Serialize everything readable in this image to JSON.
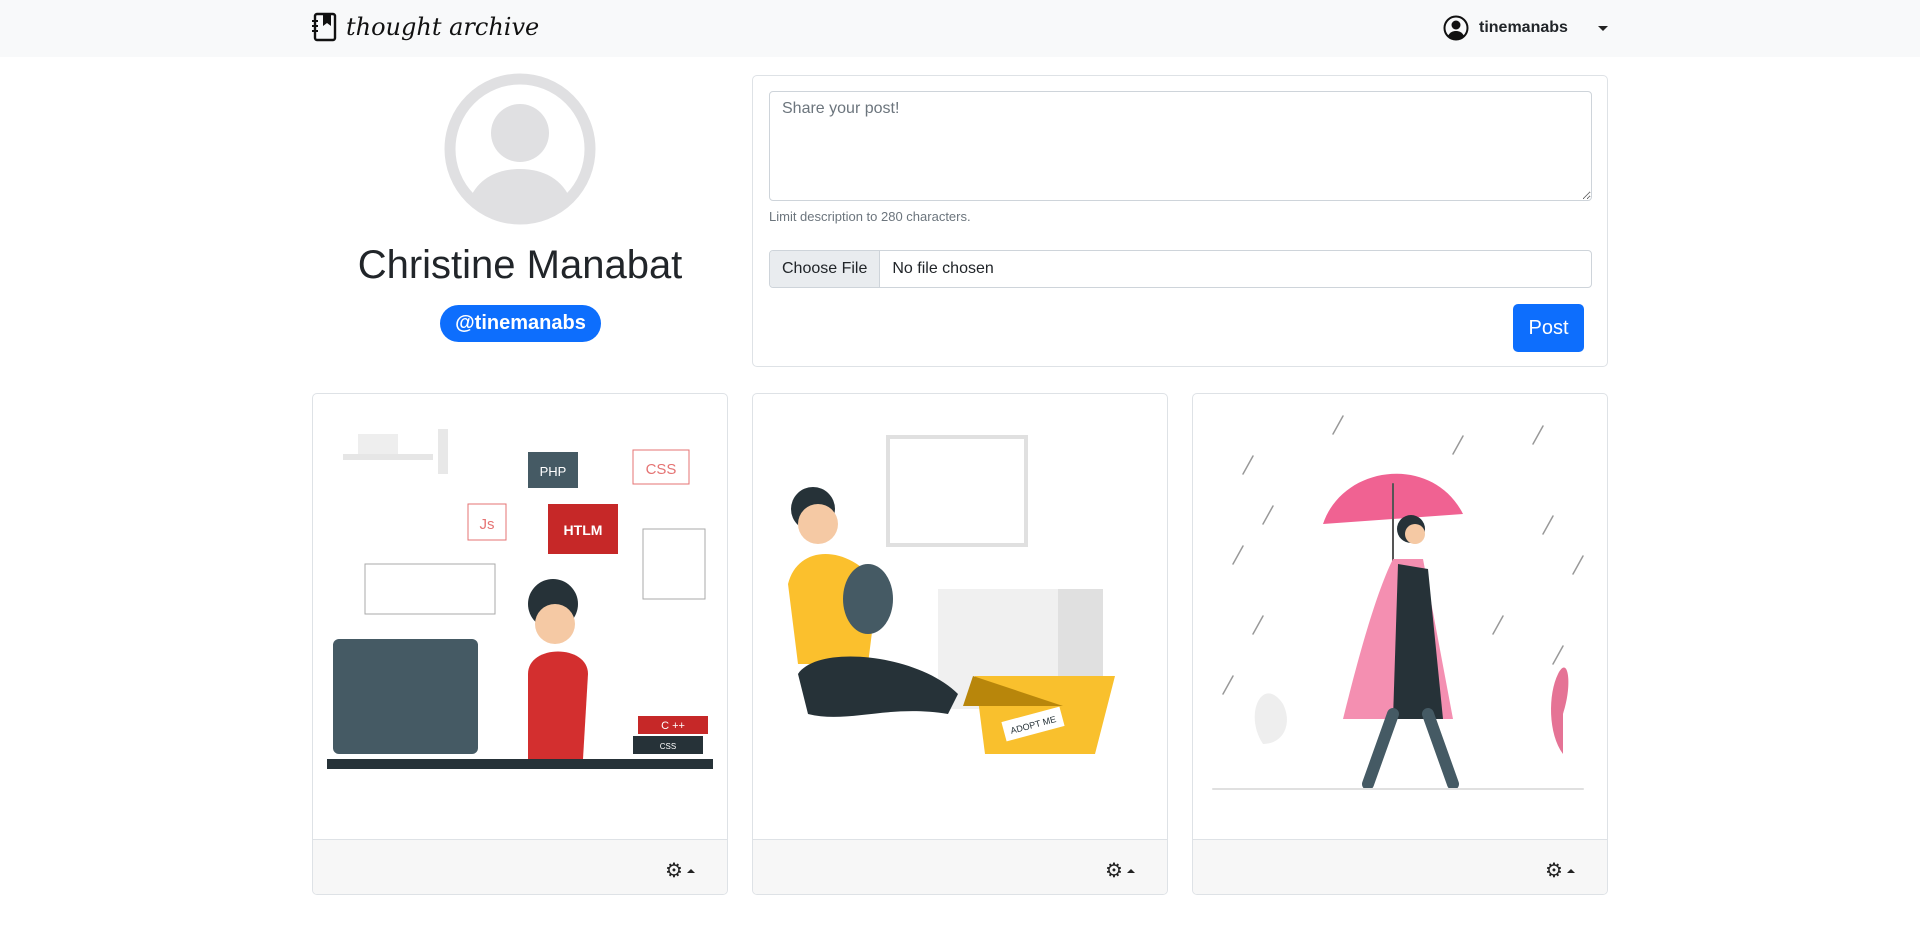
{
  "navbar": {
    "brand": "thought archive",
    "brand_icon": "journal-bookmark-icon",
    "username": "tinemanabs",
    "user_icon": "person-circle-icon"
  },
  "profile": {
    "name": "Christine Manabat",
    "handle": "@tinemanabs"
  },
  "composer": {
    "placeholder": "Share your post!",
    "value": "",
    "hint": "Limit description to 280 characters.",
    "file_button": "Choose File",
    "file_status": "No file chosen",
    "submit_label": "Post"
  },
  "posts": [
    {
      "image": "developer-at-computer-illustration",
      "image_text": [
        "PHP",
        "CSS",
        "Js",
        "HTLM",
        "C ++",
        "CSS"
      ]
    },
    {
      "image": "person-hugging-cat-illustration",
      "image_text": [
        "ADOPT ME"
      ]
    },
    {
      "image": "woman-with-umbrella-in-rain-illustration"
    }
  ],
  "colors": {
    "primary": "#0d6efd",
    "navbar": "#f8f9fa",
    "card_footer": "#f7f7f7"
  }
}
